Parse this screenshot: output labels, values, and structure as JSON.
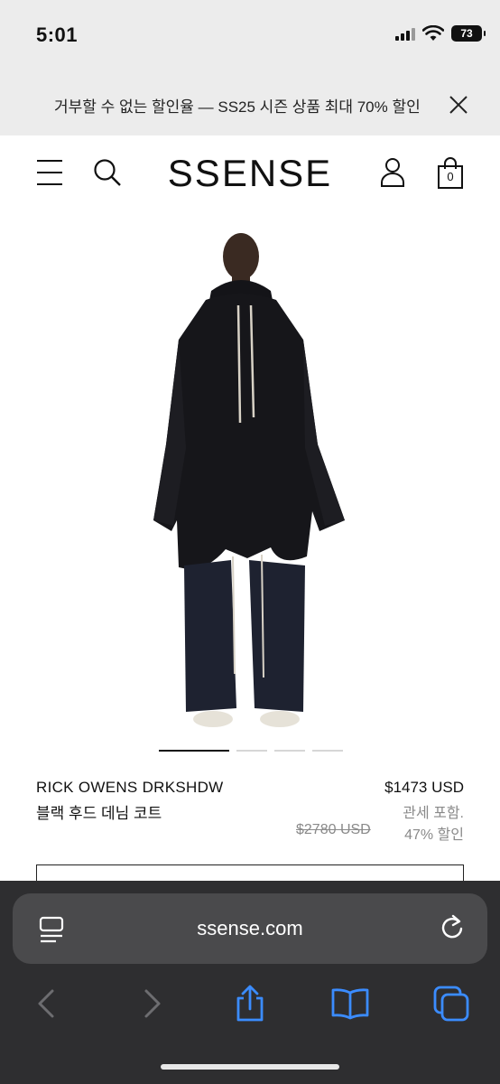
{
  "status_bar": {
    "time": "5:01",
    "battery": "73"
  },
  "promo": {
    "text": "거부할 수 없는 할인율 — SS25 시즌 상품 최대 70% 할인"
  },
  "header": {
    "logo": "SSENSE",
    "bag_count": "0"
  },
  "product": {
    "image_count": 4,
    "active_image": 1,
    "brand": "RICK OWENS DRKSHDW",
    "name": "블랙 후드 데님 코트",
    "price": "$1473 USD",
    "tax_note": "관세 포함.",
    "original_price": "$2780 USD",
    "discount": "47% 할인"
  },
  "browser": {
    "url": "ssense.com",
    "accent_color": "#3b8cff"
  }
}
